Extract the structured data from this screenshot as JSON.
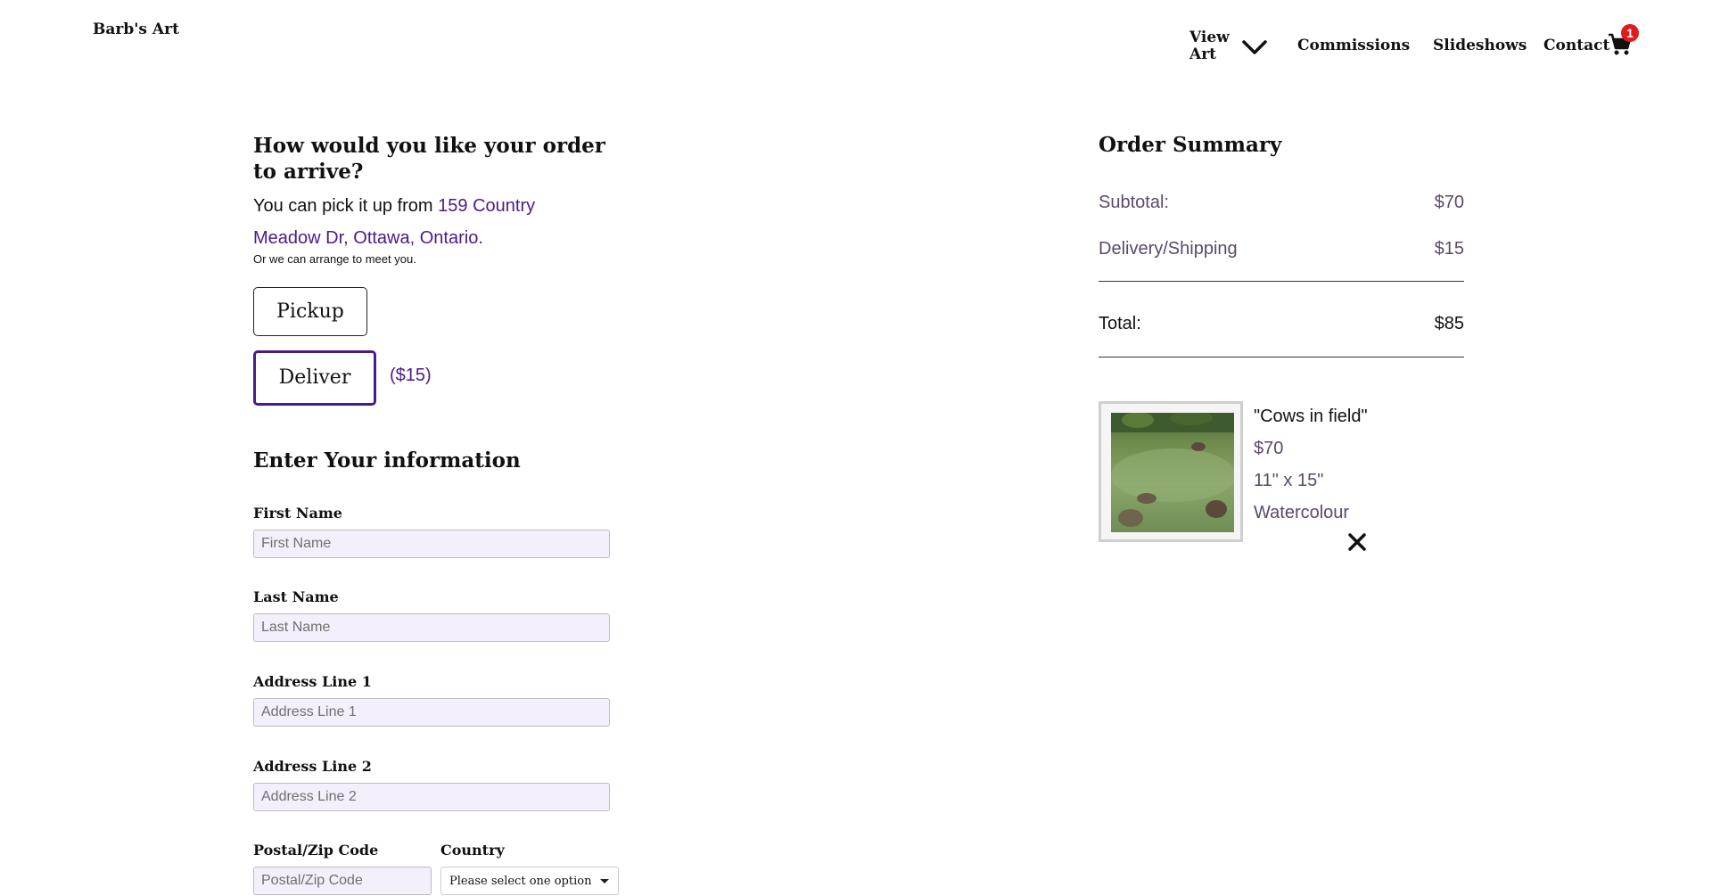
{
  "header": {
    "brand": "Barb's Art",
    "nav": {
      "view_art": "View Art",
      "commissions": "Commissions",
      "slideshows": "Slideshows",
      "contact": "Contact"
    },
    "cart_count": "1",
    "icons": [
      "chevron-down-icon",
      "cart-icon"
    ]
  },
  "delivery": {
    "title": "How would you like your order to arrive?",
    "pickup_prefix": "You can pick it up from ",
    "pickup_address": "159 Country Meadow Dr, Ottawa, Ontario.",
    "meet_text": "Or we can arrange to meet you.",
    "pickup_label": "Pickup",
    "deliver_label": "Deliver",
    "deliver_price": "($15)"
  },
  "form": {
    "title": "Enter Your information",
    "first_name": {
      "label": "First Name",
      "placeholder": "First Name"
    },
    "last_name": {
      "label": "Last Name",
      "placeholder": "Last Name"
    },
    "address1": {
      "label": "Address Line 1",
      "placeholder": "Address Line 1"
    },
    "address2": {
      "label": "Address Line 2",
      "placeholder": "Address Line 2"
    },
    "postal": {
      "label": "Postal/Zip Code",
      "placeholder": "Postal/Zip Code"
    },
    "country": {
      "label": "Country",
      "selected": "Please select one option"
    }
  },
  "summary": {
    "title": "Order Summary",
    "subtotal_label": "Subtotal:",
    "subtotal_value": "$70",
    "shipping_label": "Delivery/Shipping",
    "shipping_value": "$15",
    "total_label": "Total:",
    "total_value": "$85"
  },
  "item": {
    "title": "\"Cows in field\"",
    "price": "$70",
    "size": "11\" x 15\"",
    "medium": "Watercolour"
  },
  "colors": {
    "accent": "#4b1a8a",
    "badge": "#e01b1b",
    "input_bg": "#f3effb"
  }
}
